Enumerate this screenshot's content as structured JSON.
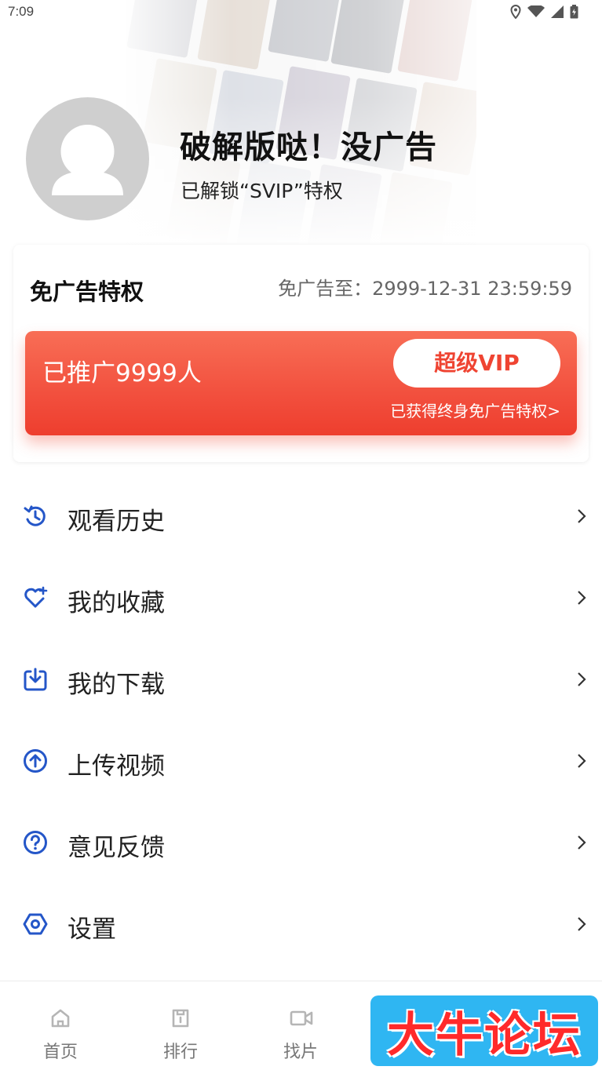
{
  "status_bar": {
    "time": "7:09",
    "icons": [
      "location-icon",
      "wifi-icon",
      "signal-icon",
      "battery-icon"
    ]
  },
  "profile": {
    "username": "破解版哒！没广告",
    "vip_status": "已解锁“SVIP”特权"
  },
  "privilege_card": {
    "title": "免广告特权",
    "expiry": "免广告至：2999-12-31 23:59:59",
    "promo": {
      "count_text": "已推广9999人",
      "vip_button_label": "超级VIP",
      "subtitle": "已获得终身免广告特权>"
    }
  },
  "menu": [
    {
      "label": "观看历史",
      "icon": "history-icon"
    },
    {
      "label": "我的收藏",
      "icon": "heart-icon"
    },
    {
      "label": "我的下载",
      "icon": "download-icon"
    },
    {
      "label": "上传视频",
      "icon": "upload-icon"
    },
    {
      "label": "意见反馈",
      "icon": "help-icon"
    },
    {
      "label": "设置",
      "icon": "settings-icon"
    }
  ],
  "bottom_nav": [
    {
      "label": "首页",
      "icon": "home-icon"
    },
    {
      "label": "排行",
      "icon": "ranking-icon"
    },
    {
      "label": "找片",
      "icon": "video-camera-icon"
    }
  ],
  "watermark": "大牛论坛",
  "colors": {
    "accent_blue": "#2456c8",
    "promo_red": "#f2503e",
    "watermark_bg": "#2fb6f2",
    "watermark_text": "#ff2a2a"
  }
}
